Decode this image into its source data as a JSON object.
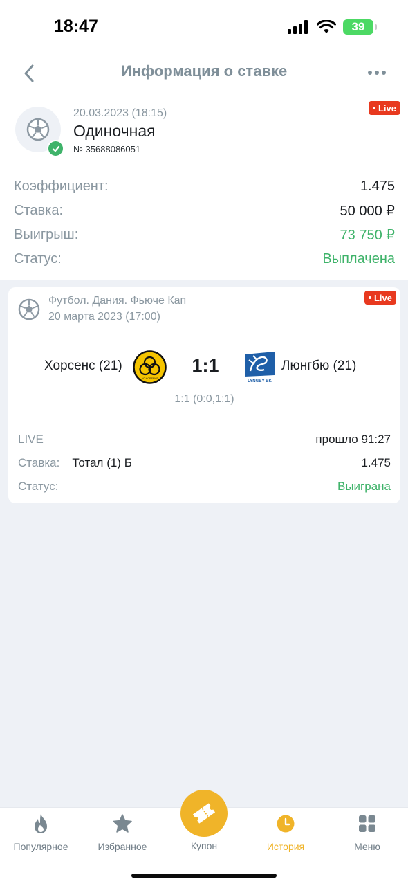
{
  "status_bar": {
    "time": "18:47",
    "battery": "39"
  },
  "header": {
    "title": "Информация о ставке"
  },
  "bet": {
    "date": "20.03.2023 (18:15)",
    "type": "Одиночная",
    "number": "№ 35688086051",
    "live_badge": "Live",
    "rows": [
      {
        "label": "Коэффициент:",
        "value": "1.475"
      },
      {
        "label": "Ставка:",
        "value": "50 000 ₽"
      },
      {
        "label": "Выигрыш:",
        "value": "73 750 ₽"
      },
      {
        "label": "Статус:",
        "value": "Выплачена"
      }
    ]
  },
  "event": {
    "league": "Футбол. Дания. Фьюче Кап",
    "date": "20 марта 2023 (17:00)",
    "live_badge": "Live",
    "team1": "Хорсенс (21)",
    "team2": "Люнгбю (21)",
    "team1_logo_text": "AC HORSENS",
    "team2_logo_text": "LYNGBY BK",
    "score": "1:1",
    "score_detail": "1:1 (0:0,1:1)",
    "live_label": "LIVE",
    "elapsed": "прошло 91:27",
    "bet_label": "Ставка:",
    "bet_market": "Тотал (1) Б",
    "bet_odds": "1.475",
    "status_label": "Статус:",
    "status_value": "Выиграна"
  },
  "tabbar": {
    "tabs": [
      {
        "label": "Популярное",
        "icon": "flame-icon"
      },
      {
        "label": "Избранное",
        "icon": "star-icon"
      },
      {
        "label": "Купон",
        "icon": "ticket-icon"
      },
      {
        "label": "История",
        "icon": "clock-icon"
      },
      {
        "label": "Меню",
        "icon": "grid-icon"
      }
    ],
    "active_tab": "История"
  },
  "colors": {
    "accent": "#f0b429",
    "green": "#3fb36a",
    "live_red": "#e8391f",
    "muted": "#8a97a0"
  }
}
